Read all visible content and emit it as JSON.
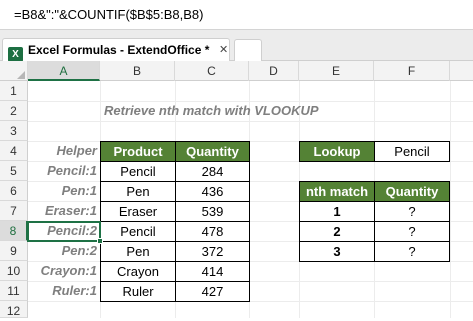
{
  "formula_bar": {
    "text": "=B8&\":\"&COUNTIF($B$5:B8,B8)"
  },
  "tabs": {
    "active_title": "Excel Formulas - ExtendOffice *",
    "close_glyph": "✕",
    "icon_letter": "X"
  },
  "columns": [
    "A",
    "B",
    "C",
    "D",
    "E",
    "F"
  ],
  "rows": [
    "1",
    "2",
    "3",
    "4",
    "5",
    "6",
    "7",
    "8",
    "9",
    "10",
    "11",
    "12"
  ],
  "sheet": {
    "title": "Retrieve nth match with VLOOKUP",
    "helper_header": "Helper",
    "helpers": [
      "Pencil:1",
      "Pen:1",
      "Eraser:1",
      "Pencil:2",
      "Pen:2",
      "Crayon:1",
      "Ruler:1"
    ],
    "product_header": "Product",
    "quantity_header": "Quantity",
    "products": [
      "Pencil",
      "Pen",
      "Eraser",
      "Pencil",
      "Pen",
      "Crayon",
      "Ruler"
    ],
    "quantities": [
      "284",
      "436",
      "539",
      "478",
      "372",
      "414",
      "427"
    ],
    "lookup_label": "Lookup",
    "lookup_value": "Pencil",
    "nth_header": "nth match",
    "result_header": "Quantity",
    "nth_values": [
      "1",
      "2",
      "3"
    ],
    "results": [
      "?",
      "?",
      "?"
    ]
  },
  "colors": {
    "header_green": "#548235",
    "selection_green": "#1e7145",
    "helper_gray": "#7f7f7f"
  }
}
